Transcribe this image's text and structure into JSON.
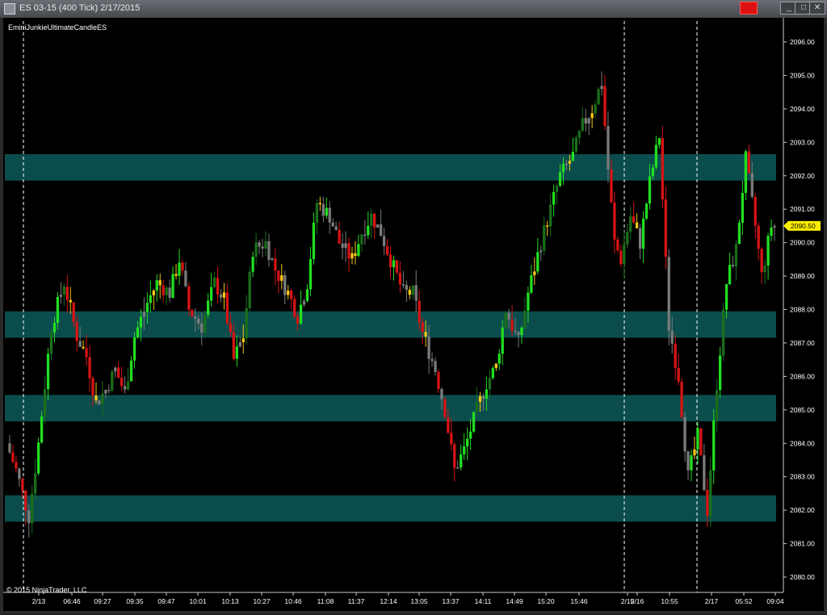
{
  "window": {
    "title": "ES 03-15 (400 Tick)  2/17/2015",
    "buttons": [
      "_",
      "□",
      "✕"
    ]
  },
  "indicator_label": "EminiJunkieUltimateCandleES",
  "copyright": "© 2015 NinjaTrader, LLC",
  "colors": {
    "background": "#000000",
    "zone": "#0b4d4d",
    "bull_strong": "#22dd22",
    "bull_weak": "#1a6e1a",
    "bear": "#d41414",
    "warning": "#f5c518",
    "neutral": "#7a7a7a",
    "price_marker": "#ffee00"
  },
  "chart_data": {
    "type": "candlestick",
    "instrument": "ES 03-15",
    "interval": "400 Tick",
    "date": "2/17/2015",
    "ylim": [
      2079.6,
      2096.6
    ],
    "y_ticks": [
      "2096.00",
      "2095.00",
      "2094.00",
      "2093.00",
      "2092.00",
      "2091.00",
      "2090.00",
      "2089.00",
      "2088.00",
      "2087.00",
      "2086.00",
      "2085.00",
      "2084.00",
      "2083.00",
      "2082.00",
      "2081.00",
      "2080.00"
    ],
    "x_ticks": [
      "2/13",
      "06:46",
      "09:27",
      "09:35",
      "09:47",
      "10:01",
      "10:13",
      "10:27",
      "10:46",
      "11:08",
      "11:37",
      "12:14",
      "13:05",
      "13:37",
      "14:11",
      "14:49",
      "15:20",
      "15:46",
      "2/15",
      "2/16",
      "10:55",
      "2/17",
      "05:52",
      "09:04"
    ],
    "session_breaks": [
      "2/13",
      "2/15",
      "2/17"
    ],
    "zones": [
      {
        "low": 2092.0,
        "high": 2092.5
      },
      {
        "low": 2087.3,
        "high": 2087.8
      },
      {
        "low": 2084.8,
        "high": 2085.3
      },
      {
        "low": 2081.8,
        "high": 2082.3
      }
    ],
    "last_price": "2090.50",
    "price_path": [
      [
        0,
        2084.0
      ],
      [
        3,
        2083.2
      ],
      [
        5,
        2082.5
      ],
      [
        7,
        2081.8
      ],
      [
        10,
        2084.0
      ],
      [
        14,
        2087.5
      ],
      [
        18,
        2088.8
      ],
      [
        22,
        2087.2
      ],
      [
        25,
        2086.6
      ],
      [
        28,
        2085.2
      ],
      [
        31,
        2085.6
      ],
      [
        34,
        2086.2
      ],
      [
        37,
        2085.5
      ],
      [
        40,
        2087.2
      ],
      [
        44,
        2088.2
      ],
      [
        47,
        2088.8
      ],
      [
        51,
        2088.5
      ],
      [
        54,
        2089.5
      ],
      [
        57,
        2088.0
      ],
      [
        61,
        2087.5
      ],
      [
        65,
        2088.8
      ],
      [
        68,
        2088.3
      ],
      [
        71,
        2086.5
      ],
      [
        74,
        2087.2
      ],
      [
        77,
        2089.8
      ],
      [
        81,
        2090.0
      ],
      [
        84,
        2089.2
      ],
      [
        88,
        2088.5
      ],
      [
        91,
        2087.8
      ],
      [
        94,
        2088.8
      ],
      [
        97,
        2091.2
      ],
      [
        101,
        2090.8
      ],
      [
        104,
        2090.0
      ],
      [
        108,
        2089.5
      ],
      [
        111,
        2090.3
      ],
      [
        114,
        2090.8
      ],
      [
        117,
        2090.3
      ],
      [
        120,
        2089.5
      ],
      [
        124,
        2088.5
      ],
      [
        127,
        2088.5
      ],
      [
        130,
        2087.3
      ],
      [
        134,
        2086.2
      ],
      [
        137,
        2085.0
      ],
      [
        140,
        2083.2
      ],
      [
        143,
        2083.8
      ],
      [
        147,
        2085.0
      ],
      [
        150,
        2085.8
      ],
      [
        153,
        2086.3
      ],
      [
        156,
        2088.0
      ],
      [
        160,
        2087.0
      ],
      [
        163,
        2088.5
      ],
      [
        167,
        2090.0
      ],
      [
        170,
        2091.0
      ],
      [
        173,
        2092.0
      ],
      [
        177,
        2092.6
      ],
      [
        180,
        2093.5
      ],
      [
        183,
        2094.0
      ],
      [
        186,
        2094.8
      ],
      [
        188,
        2092.2
      ],
      [
        190,
        2090.0
      ],
      [
        192,
        2089.5
      ],
      [
        195,
        2090.8
      ],
      [
        198,
        2090.0
      ],
      [
        201,
        2091.8
      ],
      [
        204,
        2093.2
      ],
      [
        207,
        2087.5
      ],
      [
        210,
        2086.0
      ],
      [
        213,
        2083.0
      ],
      [
        216,
        2084.2
      ],
      [
        219,
        2082.0
      ],
      [
        222,
        2085.8
      ],
      [
        225,
        2088.8
      ],
      [
        228,
        2089.8
      ],
      [
        231,
        2092.5
      ],
      [
        234,
        2090.5
      ],
      [
        236,
        2089.0
      ],
      [
        239,
        2090.5
      ]
    ]
  }
}
